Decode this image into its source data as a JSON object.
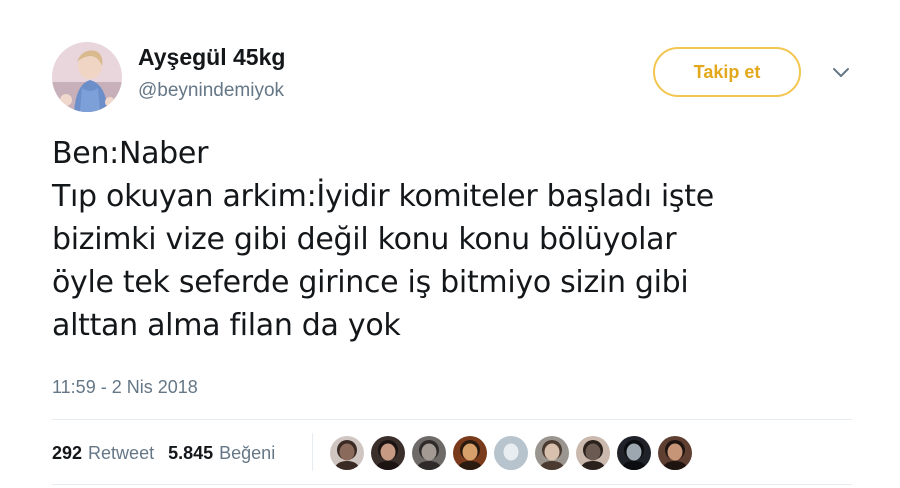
{
  "user": {
    "display_name": "Ayşegül 45kg",
    "handle": "@beynindemiyok",
    "avatar_icon": "profile-photo"
  },
  "follow_button": {
    "label": "Takip et",
    "color": "#e3a81c"
  },
  "menu_icon": "chevron-down-icon",
  "tweet": {
    "lines": [
      "Ben:Naber",
      "Tıp okuyan arkim:İyidir komiteler başladı işte",
      "bizimki vize gibi değil konu konu bölüyolar",
      "öyle tek seferde girince iş bitmiyo sizin gibi",
      "alttan alma filan da yok"
    ],
    "timestamp": "11:59 - 2 Nis 2018"
  },
  "stats": {
    "retweets": {
      "count": "292",
      "label": "Retweet"
    },
    "likes": {
      "count": "5.845",
      "label": "Beğeni"
    }
  },
  "likers": [
    {
      "bg": "#cfc6c2",
      "face": "#8a6a5a",
      "hair": "#3a2a24"
    },
    {
      "bg": "#3b2f2c",
      "face": "#c79a84",
      "hair": "#1c1412"
    },
    {
      "bg": "#6e6a68",
      "face": "#a39a94",
      "hair": "#2e2b2a"
    },
    {
      "bg": "#7a3a1c",
      "face": "#d7a06a",
      "hair": "#2a1a10"
    },
    {
      "bg": "#b7c3cd",
      "face": "#e8edf1",
      "hair": "#b7c3cd"
    },
    {
      "bg": "#9a958e",
      "face": "#d8c0ae",
      "hair": "#4a3a30"
    },
    {
      "bg": "#cbb9ad",
      "face": "#6b5a52",
      "hair": "#2a211d"
    },
    {
      "bg": "#1f2329",
      "face": "#9da7b0",
      "hair": "#0b0d10"
    },
    {
      "bg": "#5e3f31",
      "face": "#c69476",
      "hair": "#1e1410"
    }
  ]
}
